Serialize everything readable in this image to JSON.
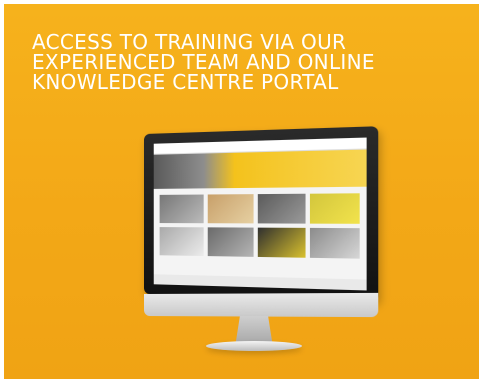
{
  "headline": {
    "lines": [
      "ACCESS TO TRAINING VIA OUR",
      "EXPERIENCED TEAM AND ONLINE",
      "KNOWLEDGE CENTRE PORTAL"
    ]
  },
  "colors": {
    "background": "#f3a817",
    "text": "#ffffff",
    "accent": "#f4c21c"
  },
  "image": {
    "icon": "desktop-monitor-icon"
  }
}
